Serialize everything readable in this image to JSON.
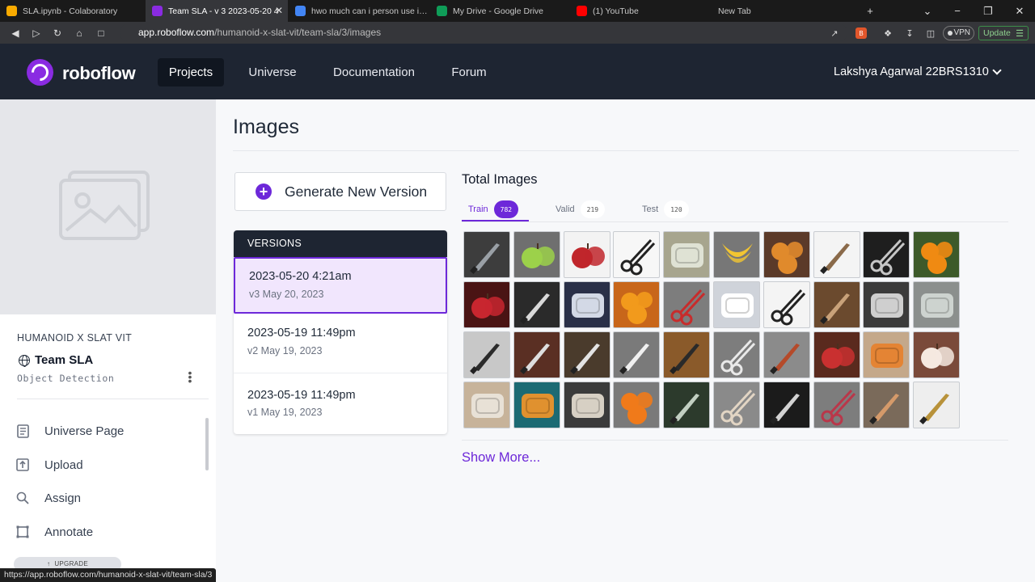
{
  "browser": {
    "tabs": [
      {
        "label": "SLA.ipynb - Colaboratory",
        "icon": "colab-icon",
        "color": "#f9ab00"
      },
      {
        "label": "Team SLA - v 3 2023-05-20 4",
        "icon": "roboflow-icon",
        "color": "#8a2be2",
        "active": true
      },
      {
        "label": "hwo much can i person use in go",
        "icon": "google-icon",
        "color": "#4285f4"
      },
      {
        "label": "My Drive - Google Drive",
        "icon": "drive-icon",
        "color": "#0f9d58"
      },
      {
        "label": "(1) YouTube",
        "icon": "youtube-icon",
        "color": "#ff0000"
      },
      {
        "label": "New Tab",
        "icon": "",
        "color": ""
      }
    ],
    "url_host": "app.roboflow.com",
    "url_path": "/humanoid-x-slat-vit/team-sla/3/images",
    "vpn_label": "VPN",
    "update_label": "Update",
    "status_url": "https://app.roboflow.com/humanoid-x-slat-vit/team-sla/3"
  },
  "nav": {
    "logo_text": "roboflow",
    "items": [
      {
        "label": "Projects",
        "active": true
      },
      {
        "label": "Universe"
      },
      {
        "label": "Documentation"
      },
      {
        "label": "Forum"
      }
    ],
    "user": "Lakshya Agarwal 22BRS1310"
  },
  "sidebar": {
    "project_name": "HUMANOID X SLAT VIT",
    "team_name": "Team SLA",
    "project_type": "Object Detection",
    "items": [
      {
        "label": "Universe Page",
        "icon": "page-icon"
      },
      {
        "label": "Upload",
        "icon": "upload-icon"
      },
      {
        "label": "Assign",
        "icon": "search-icon"
      },
      {
        "label": "Annotate",
        "icon": "annotate-icon"
      }
    ],
    "upgrade_label": "UPGRADE"
  },
  "main": {
    "title": "Images",
    "generate_label": "Generate New Version",
    "versions_header": "VERSIONS",
    "versions": [
      {
        "date": "2023-05-20 4:21am",
        "sub": "v3 May 20, 2023",
        "selected": true
      },
      {
        "date": "2023-05-19 11:49pm",
        "sub": "v2 May 19, 2023"
      },
      {
        "date": "2023-05-19 11:49pm",
        "sub": "v1 May 19, 2023"
      }
    ],
    "total_images_title": "Total Images",
    "tabs": [
      {
        "label": "Train",
        "count": "782",
        "active": true
      },
      {
        "label": "Valid",
        "count": "219"
      },
      {
        "label": "Test",
        "count": "120"
      }
    ],
    "show_more": "Show More...",
    "thumbnails": [
      {
        "subject": "knife",
        "bg": "#3d3d3d",
        "fg": "#9aa0a6"
      },
      {
        "subject": "apple",
        "bg": "#6f6f6f",
        "fg": "#9cd14a"
      },
      {
        "subject": "apple",
        "bg": "#f3f3f3",
        "fg": "#c0262b"
      },
      {
        "subject": "scissors",
        "bg": "#f7f7f7",
        "fg": "#222222"
      },
      {
        "subject": "pillow",
        "bg": "#a7a58e",
        "fg": "#dfe2d4"
      },
      {
        "subject": "banana",
        "bg": "#777777",
        "fg": "#f2c531"
      },
      {
        "subject": "orange",
        "bg": "#5b3a29",
        "fg": "#e08a2c"
      },
      {
        "subject": "knife",
        "bg": "#f4f4f4",
        "fg": "#8a6a4a"
      },
      {
        "subject": "scissors",
        "bg": "#1e1e1e",
        "fg": "#c6c6c6"
      },
      {
        "subject": "orange",
        "bg": "#3d5a2a",
        "fg": "#f08a12"
      },
      {
        "subject": "apple",
        "bg": "#4a1414",
        "fg": "#c8262f"
      },
      {
        "subject": "knife",
        "bg": "#2a2a2a",
        "fg": "#d9d9d9"
      },
      {
        "subject": "pillow",
        "bg": "#2a3048",
        "fg": "#d3d9e6"
      },
      {
        "subject": "orange",
        "bg": "#c8661a",
        "fg": "#f29a1c"
      },
      {
        "subject": "scissors",
        "bg": "#7d7d7d",
        "fg": "#c72c2c"
      },
      {
        "subject": "pillow",
        "bg": "#cfd3da",
        "fg": "#ffffff"
      },
      {
        "subject": "scissors",
        "bg": "#f4f4f4",
        "fg": "#222222"
      },
      {
        "subject": "knife",
        "bg": "#6b4a2e",
        "fg": "#c9a27a"
      },
      {
        "subject": "pillow",
        "bg": "#3b3b3b",
        "fg": "#cfcfcf"
      },
      {
        "subject": "pillow",
        "bg": "#8b8f8d",
        "fg": "#cdd3cf"
      },
      {
        "subject": "knife",
        "bg": "#c8c8c8",
        "fg": "#2b2b2b"
      },
      {
        "subject": "knife",
        "bg": "#5a2f23",
        "fg": "#dedede"
      },
      {
        "subject": "knife",
        "bg": "#4a3b2c",
        "fg": "#e3e3e3"
      },
      {
        "subject": "knife",
        "bg": "#7a7a7a",
        "fg": "#f0f0f0"
      },
      {
        "subject": "knife",
        "bg": "#8a5a2a",
        "fg": "#2a2a2a"
      },
      {
        "subject": "scissors",
        "bg": "#7d7d7d",
        "fg": "#e9e9e9"
      },
      {
        "subject": "knife",
        "bg": "#8b8b8b",
        "fg": "#b54a2a"
      },
      {
        "subject": "apple",
        "bg": "#5a2a1e",
        "fg": "#c93030"
      },
      {
        "subject": "pillow",
        "bg": "#c4a88a",
        "fg": "#e48434"
      },
      {
        "subject": "apple",
        "bg": "#7a4a3a",
        "fg": "#f5e9e0"
      },
      {
        "subject": "pillow",
        "bg": "#c7b39a",
        "fg": "#e8e1d6"
      },
      {
        "subject": "pillow",
        "bg": "#1c6a73",
        "fg": "#e0912f"
      },
      {
        "subject": "pillow",
        "bg": "#3b3b3b",
        "fg": "#d7d0c4"
      },
      {
        "subject": "orange",
        "bg": "#7a7a7a",
        "fg": "#f07a1a"
      },
      {
        "subject": "knife",
        "bg": "#2c3a2c",
        "fg": "#c2cfc2"
      },
      {
        "subject": "scissors",
        "bg": "#8a8a8a",
        "fg": "#e2d5c4"
      },
      {
        "subject": "knife",
        "bg": "#1b1b1b",
        "fg": "#d3d3d3"
      },
      {
        "subject": "scissors",
        "bg": "#7d7d7d",
        "fg": "#b9374a"
      },
      {
        "subject": "knife",
        "bg": "#7a6a5a",
        "fg": "#d59a6a"
      },
      {
        "subject": "knife",
        "bg": "#eeeeee",
        "fg": "#b8923a"
      }
    ]
  }
}
